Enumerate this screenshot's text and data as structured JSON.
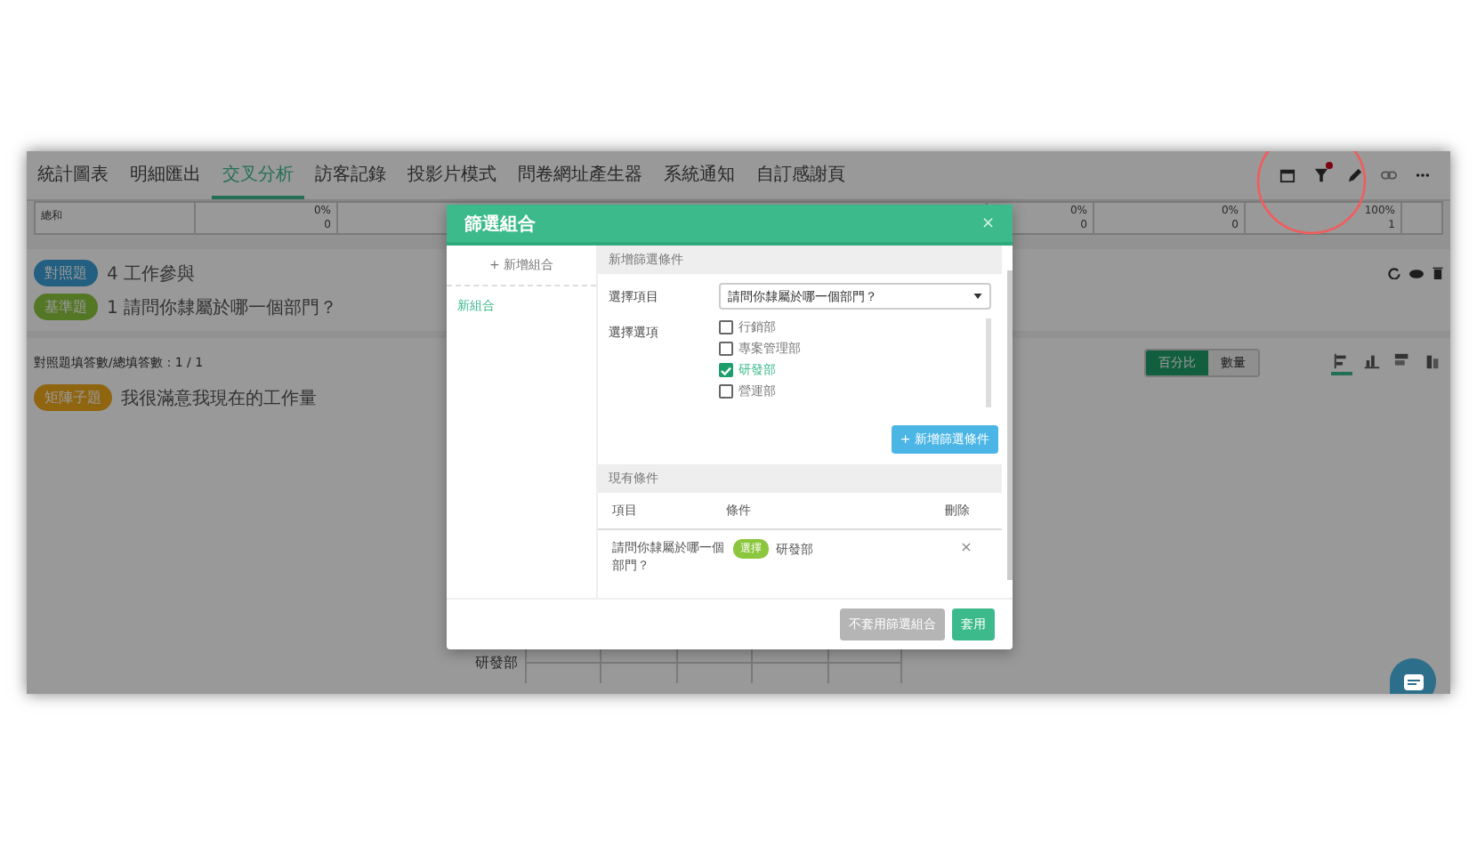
{
  "tabs": [
    {
      "label": "統計圖表",
      "selected": false
    },
    {
      "label": "明細匯出",
      "selected": false
    },
    {
      "label": "交叉分析",
      "selected": true
    },
    {
      "label": "訪客記錄",
      "selected": false
    },
    {
      "label": "投影片模式",
      "selected": false
    },
    {
      "label": "問卷網址產生器",
      "selected": false
    },
    {
      "label": "系統通知",
      "selected": false
    },
    {
      "label": "自訂感謝頁",
      "selected": false
    }
  ],
  "toolbar_icons": [
    {
      "kind": "calendar",
      "badge": false
    },
    {
      "kind": "filter",
      "badge": true
    },
    {
      "kind": "pencil",
      "badge": false
    },
    {
      "kind": "link",
      "badge": false
    },
    {
      "kind": "more",
      "badge": false
    }
  ],
  "summary_row": {
    "label": "總和",
    "cells_left": [
      {
        "percent": "0%",
        "count": "0"
      }
    ],
    "cells_right": [
      {
        "percent": "0%",
        "count": "0"
      },
      {
        "percent": "0%",
        "count": "0"
      },
      {
        "percent": "100%",
        "count": "1"
      }
    ]
  },
  "question": {
    "compare_tag": "對照題",
    "compare_text": "4 工作參與",
    "base_tag": "基準題",
    "base_text": "1 請問你隸屬於哪一個部門？"
  },
  "result": {
    "count_text": "對照題填答數/總填答數：1 / 1",
    "modes": [
      {
        "label": "百分比",
        "selected": true
      },
      {
        "label": "數量",
        "selected": false
      }
    ],
    "chart_types": [
      {
        "kind": "bar",
        "selected": true
      },
      {
        "kind": "column",
        "selected": false
      },
      {
        "kind": "stacked-bar",
        "selected": false
      },
      {
        "kind": "stacked-column",
        "selected": false
      }
    ],
    "subquestion_tag": "矩陣子題",
    "subquestion_text": "我很滿意我現在的工作量",
    "row_label": "研發部"
  },
  "dialog": {
    "title": "篩選組合",
    "close": "×",
    "add_group": "+ 新增組合",
    "groups": [
      {
        "label": "新組合",
        "selected": true
      }
    ],
    "new_section": "新增篩選條件",
    "item_label": "選擇項目",
    "item_value": "請問你隸屬於哪一個部門？",
    "option_label": "選擇選項",
    "options": [
      {
        "label": "行銷部",
        "checked": false
      },
      {
        "label": "專案管理部",
        "checked": false
      },
      {
        "label": "研發部",
        "checked": true
      },
      {
        "label": "營運部",
        "checked": false
      }
    ],
    "add_condition": "+ 新增篩選條件",
    "existing_section": "現有條件",
    "columns": [
      "項目",
      "條件",
      "刪除"
    ],
    "conditions": [
      {
        "item": "請問你隸屬於哪一個部門？",
        "tag": "選擇",
        "value": "研發部",
        "delete": "×"
      }
    ],
    "buttons": [
      {
        "label": "不套用篩選組合",
        "kind": "secondary"
      },
      {
        "label": "套用",
        "kind": "primary"
      }
    ]
  }
}
